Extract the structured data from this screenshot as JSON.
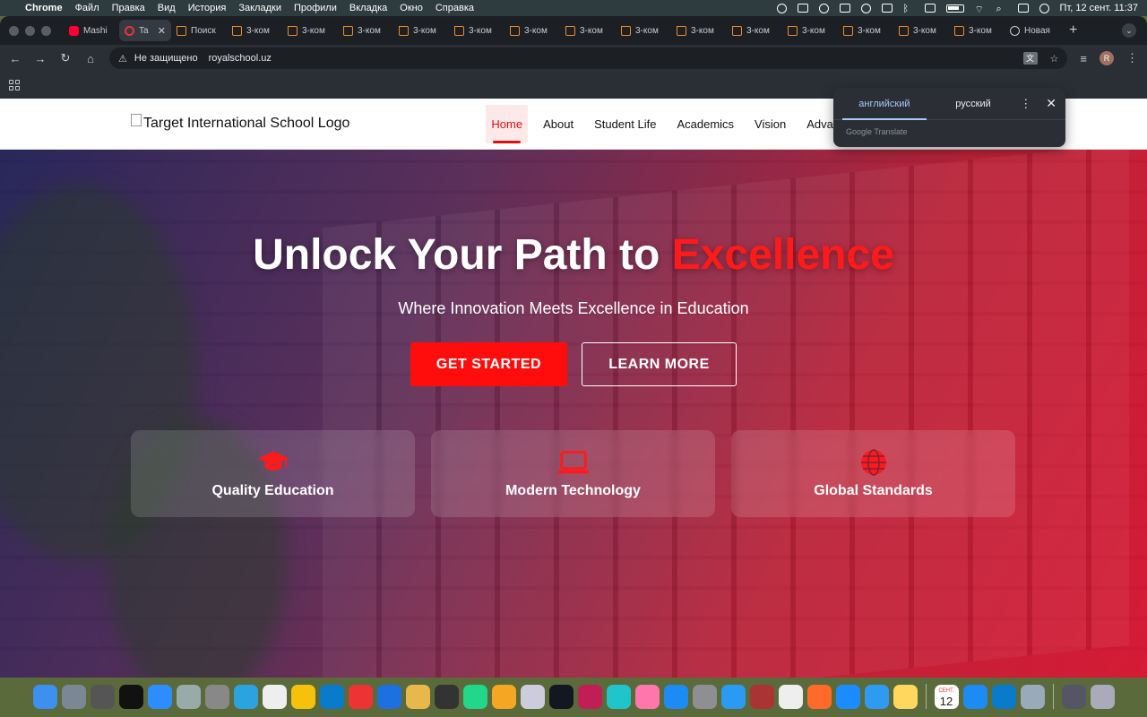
{
  "menubar": {
    "app": "Chrome",
    "items": [
      "Файл",
      "Правка",
      "Вид",
      "История",
      "Закладки",
      "Профили",
      "Вкладка",
      "Окно",
      "Справка"
    ],
    "clock": "Пт, 12 сент.  11:37"
  },
  "tabs": [
    {
      "title": "Mashi",
      "icon": "youtube-icon"
    },
    {
      "title": "Ta",
      "icon": "target-icon",
      "active": true
    },
    {
      "title": "Поиск",
      "icon": "house-icon"
    },
    {
      "title": "3-ком",
      "icon": "house-icon"
    },
    {
      "title": "3-ком",
      "icon": "house-icon"
    },
    {
      "title": "3-ком",
      "icon": "house-icon"
    },
    {
      "title": "3-ком",
      "icon": "house-icon"
    },
    {
      "title": "3-ком",
      "icon": "house-icon"
    },
    {
      "title": "3-ком",
      "icon": "house-icon"
    },
    {
      "title": "3-ком",
      "icon": "house-icon"
    },
    {
      "title": "3-ком",
      "icon": "house-icon"
    },
    {
      "title": "3-ком",
      "icon": "house-icon"
    },
    {
      "title": "3-ком",
      "icon": "house-icon"
    },
    {
      "title": "3-ком",
      "icon": "house-icon"
    },
    {
      "title": "3-ком",
      "icon": "house-icon"
    },
    {
      "title": "3-ком",
      "icon": "house-icon"
    },
    {
      "title": "3-ком",
      "icon": "house-icon"
    },
    {
      "title": "Новая",
      "icon": "chrome-icon"
    }
  ],
  "address": {
    "security": "Не защищено",
    "url": "royalschool.uz",
    "avatar_letter": "R"
  },
  "site": {
    "logo_alt": "Target International School Logo",
    "nav": [
      "Home",
      "About",
      "Student Life",
      "Academics",
      "Vision",
      "Advantages"
    ],
    "hero": {
      "title_main": "Unlock Your Path to ",
      "title_accent": "Excellence",
      "subtitle": "Where Innovation Meets Excellence in Education",
      "primary_button": "GET STARTED",
      "secondary_button": "LEARN MORE",
      "accent_color": "#ff1a1a"
    },
    "features": [
      {
        "label": "Quality Education",
        "icon": "graduation-cap-icon"
      },
      {
        "label": "Modern Technology",
        "icon": "laptop-icon"
      },
      {
        "label": "Global Standards",
        "icon": "globe-icon"
      }
    ]
  },
  "translate_popup": {
    "source_lang": "английский",
    "target_lang": "русский",
    "brand": "Google Translate"
  },
  "dock": {
    "calendar_day": "12",
    "calendar_month": "СЕНТ."
  }
}
